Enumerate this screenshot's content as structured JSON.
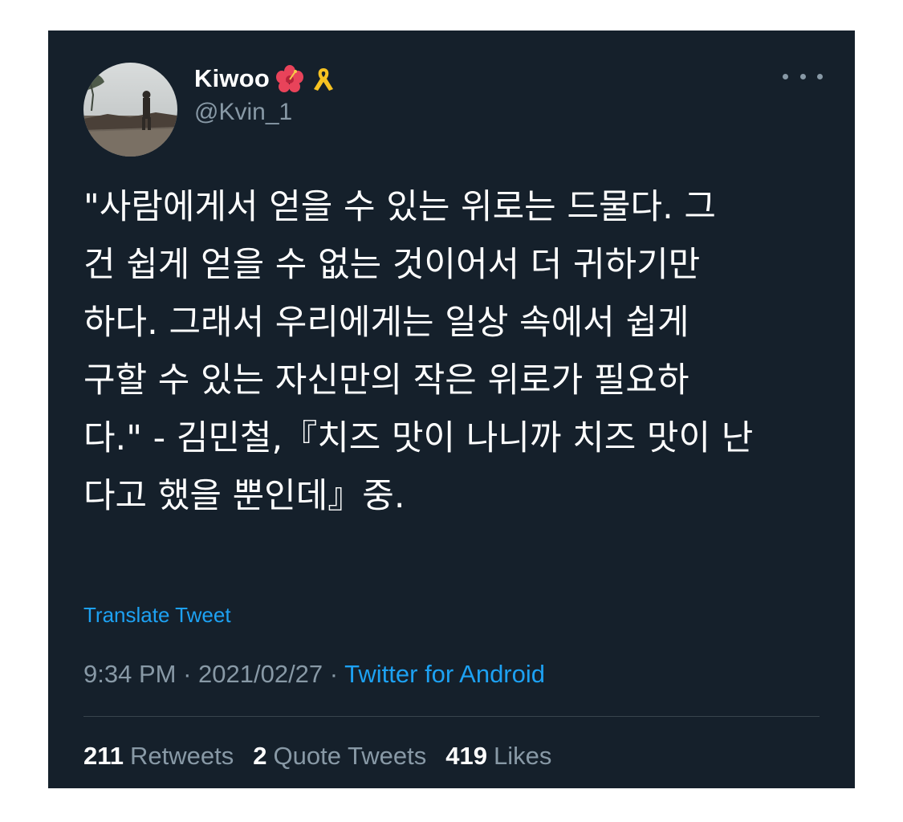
{
  "colors": {
    "background": "#15202b",
    "text_primary": "#ffffff",
    "text_secondary": "#8899a6",
    "link": "#1da1f2",
    "divider": "#38444d"
  },
  "author": {
    "display_name": "Kiwoo",
    "handle": "@Kvin_1",
    "name_emojis": [
      "hibiscus-icon",
      "yellow-ribbon-icon"
    ],
    "avatar": "profile-photo"
  },
  "more_menu_icon": "more-horizontal-icon",
  "tweet": {
    "text_lines": [
      "\"사람에게서 얻을 수 있는 위로는 드물다. 그",
      "건 쉽게 얻을 수 없는 것이어서 더 귀하기만",
      "하다. 그래서 우리에게는 일상 속에서 쉽게",
      "구할 수 있는 자신만의 작은 위로가 필요하",
      "다.\" - 김민철,『치즈 맛이 나니까 치즈 맛이 난",
      "다고 했을 뿐인데』중."
    ],
    "translate_label": "Translate Tweet",
    "time": "9:34 PM",
    "separator": " · ",
    "date": "2021/02/27",
    "source": "Twitter for Android"
  },
  "stats": {
    "retweets_count": "211",
    "retweets_label": "Retweets",
    "quotes_count": "2",
    "quotes_label": "Quote Tweets",
    "likes_count": "419",
    "likes_label": "Likes"
  }
}
